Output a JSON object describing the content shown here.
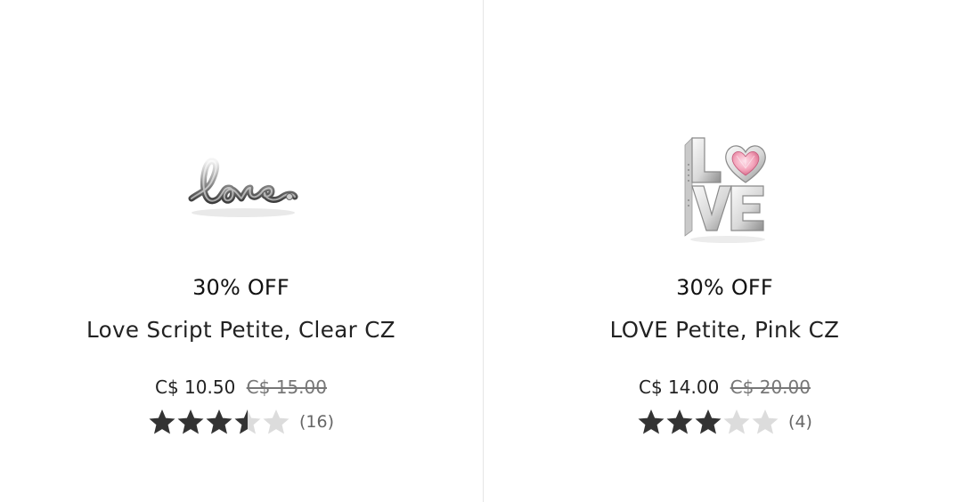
{
  "products": [
    {
      "discount": "30% OFF",
      "name": "Love Script Petite, Clear CZ",
      "price_now": "C$ 10.50",
      "price_was": "C$ 15.00",
      "rating": 3.5,
      "review_count": "(16)",
      "image_icon": "love-script-charm"
    },
    {
      "discount": "30% OFF",
      "name": "LOVE Petite, Pink CZ",
      "price_now": "C$ 14.00",
      "price_was": "C$ 20.00",
      "rating": 3,
      "review_count": "(4)",
      "image_icon": "love-letters-heart-charm"
    }
  ],
  "colors": {
    "star_filled": "#333333",
    "star_empty": "#dcdcdc",
    "heart_stone": "#f4a7bd"
  }
}
